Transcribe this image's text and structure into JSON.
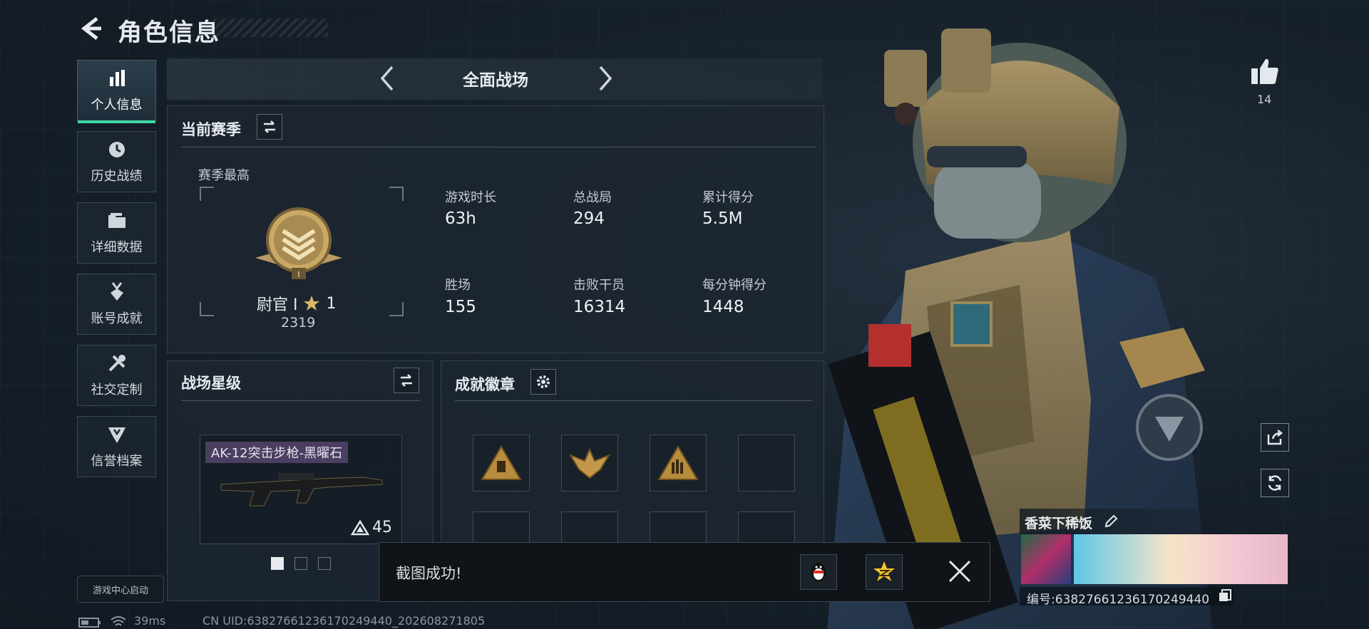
{
  "header": {
    "title": "角色信息"
  },
  "sidebar": {
    "items": [
      {
        "label": "个人信息",
        "icon": "bar-chart-icon",
        "active": true
      },
      {
        "label": "历史战绩",
        "icon": "history-icon"
      },
      {
        "label": "详细数据",
        "icon": "folder-icon"
      },
      {
        "label": "账号成就",
        "icon": "medal-icon"
      },
      {
        "label": "社交定制",
        "icon": "tools-icon"
      },
      {
        "label": "信誉档案",
        "icon": "shield-badge-icon"
      }
    ],
    "launch_badge": "游戏中心启动"
  },
  "mode": {
    "title": "全面战场"
  },
  "season": {
    "title": "当前赛季",
    "best_label": "赛季最高",
    "rank_name": "尉官 I",
    "rank_stars": "1",
    "rank_score": "2319",
    "stats": [
      {
        "label": "游戏时长",
        "value": "63h"
      },
      {
        "label": "总战局",
        "value": "294"
      },
      {
        "label": "累计得分",
        "value": "5.5M"
      },
      {
        "label": "胜场",
        "value": "155"
      },
      {
        "label": "击败干员",
        "value": "16314"
      },
      {
        "label": "每分钟得分",
        "value": "1448"
      }
    ]
  },
  "star_level": {
    "title": "战场星级",
    "weapon_name": "AK-12突击步枪-黑曜石",
    "weapon_level": "45"
  },
  "achievements": {
    "title": "成就徽章"
  },
  "toast": {
    "text": "截图成功!"
  },
  "profile": {
    "likes": "14",
    "name": "香菜下稀饭",
    "id_text": "编号:638276612361702494​40"
  },
  "status_bar": {
    "ping": "39ms",
    "uid": "CN UID:63827661236170249440_202608271805"
  },
  "colors": {
    "accent": "#3fd7a2",
    "gold": "#c9a35a",
    "background": "#17212b"
  }
}
